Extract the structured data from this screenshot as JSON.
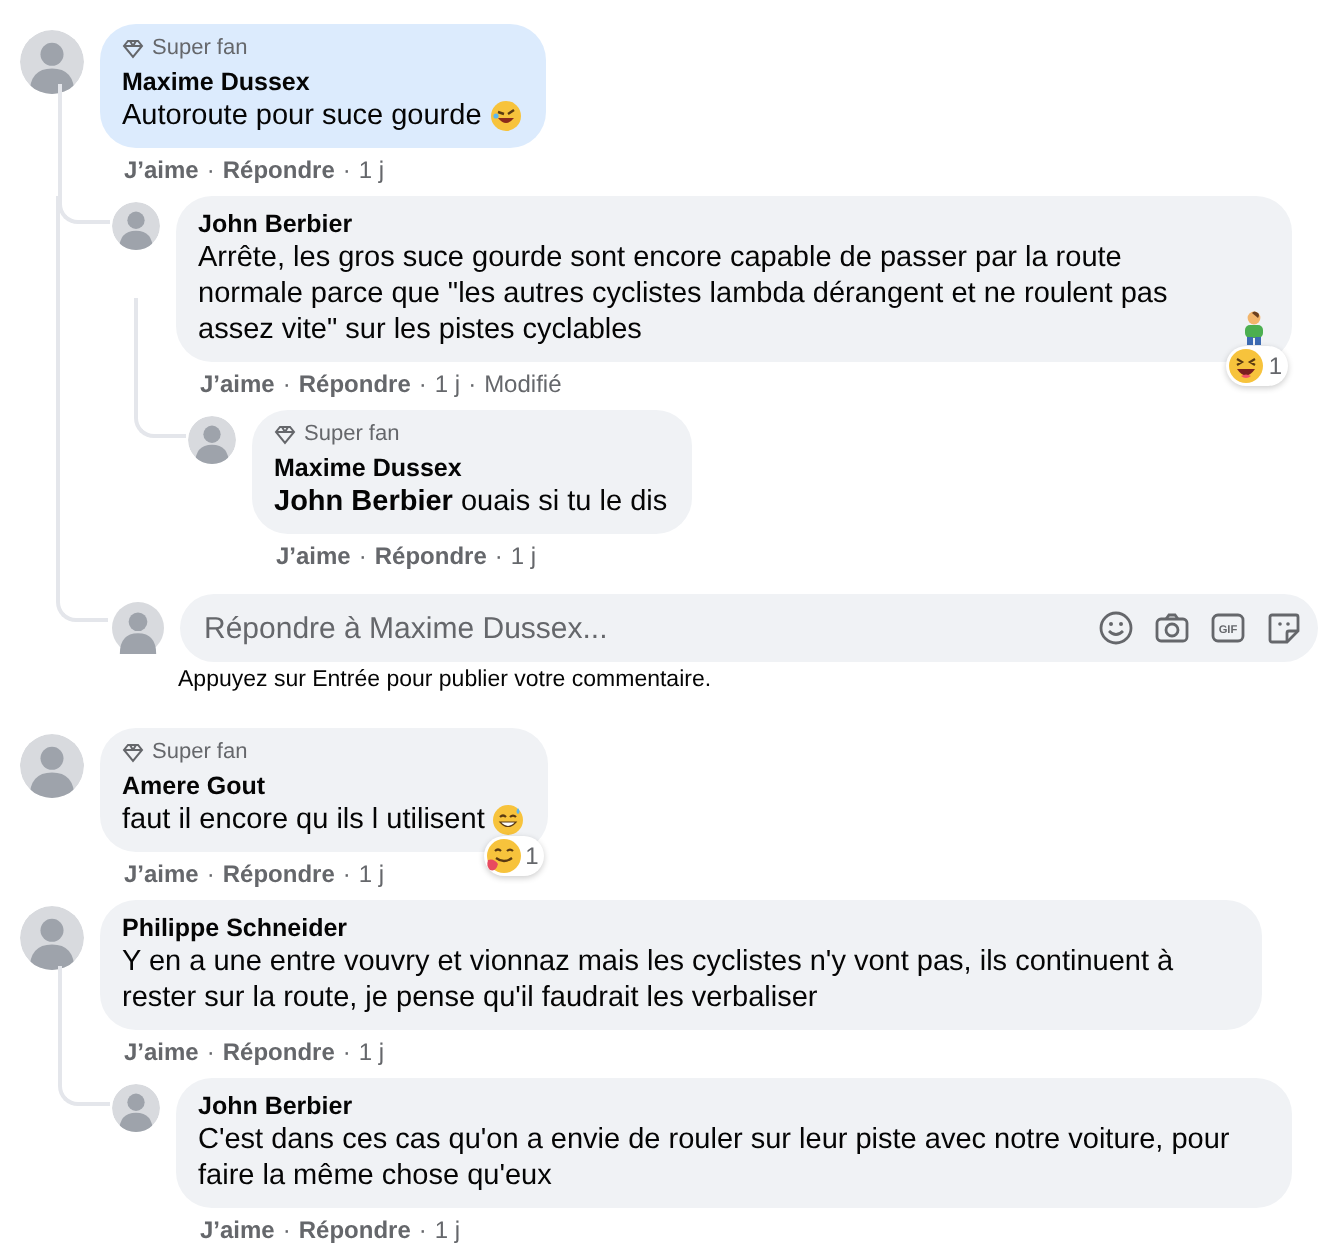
{
  "separator": "·",
  "comments": [
    {
      "author": "Maxime Dussex",
      "badge": "Super fan",
      "highlighted": true,
      "text": "Autoroute pour suce gourde",
      "emoji": {
        "kind": "rofl"
      },
      "actions": [
        {
          "label": "J’aime",
          "kind": "link"
        },
        {
          "label": "Répondre",
          "kind": "link"
        },
        {
          "label": "1 j",
          "kind": "meta"
        }
      ],
      "replies": [
        {
          "author": "John Berbier",
          "highlighted": false,
          "text": "Arrête, les gros suce gourde sont encore capable de passer par la route normale parce que \"les autres cyclistes lambda dérangent et ne roulent pas assez vite\" sur les pistes cyclables",
          "emoji": {
            "kind": "person"
          },
          "reaction": {
            "kind": "haha",
            "count": "1"
          },
          "actions": [
            {
              "label": "J’aime",
              "kind": "link"
            },
            {
              "label": "Répondre",
              "kind": "link"
            },
            {
              "label": "1 j",
              "kind": "meta"
            },
            {
              "label": "Modifié",
              "kind": "meta"
            }
          ],
          "replies": [
            {
              "author": "Maxime Dussex",
              "badge": "Super fan",
              "highlighted": false,
              "text": "**John Berbier** ouais si tu le dis",
              "actions": [
                {
                  "label": "J’aime",
                  "kind": "link"
                },
                {
                  "label": "Répondre",
                  "kind": "link"
                },
                {
                  "label": "1 j",
                  "kind": "meta"
                }
              ]
            }
          ]
        }
      ],
      "reply_field": {
        "placeholder": "Répondre à Maxime Dussex...",
        "hint": "Appuyez sur Entrée pour publier votre commentaire.",
        "tools": [
          {
            "kind": "emoji"
          },
          {
            "kind": "camera"
          },
          {
            "kind": "gif",
            "label": "GIF"
          },
          {
            "kind": "sticker"
          }
        ]
      }
    },
    {
      "author": "Amere Gout",
      "badge": "Super fan",
      "highlighted": false,
      "text": "faut il encore qu ils l utilisent",
      "emoji": {
        "kind": "grin"
      },
      "reaction": {
        "kind": "yum",
        "count": "1"
      },
      "actions": [
        {
          "label": "J’aime",
          "kind": "link"
        },
        {
          "label": "Répondre",
          "kind": "link"
        },
        {
          "label": "1 j",
          "kind": "meta"
        }
      ]
    },
    {
      "author": "Philippe Schneider",
      "highlighted": false,
      "text": "Y en a une entre vouvry et vionnaz mais les cyclistes n'y vont pas, ils continuent à rester sur la route, je pense qu'il faudrait les verbaliser",
      "actions": [
        {
          "label": "J’aime",
          "kind": "link"
        },
        {
          "label": "Répondre",
          "kind": "link"
        },
        {
          "label": "1 j",
          "kind": "meta"
        }
      ],
      "replies": [
        {
          "author": "John Berbier",
          "highlighted": false,
          "text": "C'est dans ces cas qu'on a envie de rouler sur leur piste avec notre voiture, pour faire la même chose qu'eux",
          "actions": [
            {
              "label": "J’aime",
              "kind": "link"
            },
            {
              "label": "Répondre",
              "kind": "link"
            },
            {
              "label": "1 j",
              "kind": "meta"
            }
          ]
        }
      ]
    }
  ]
}
